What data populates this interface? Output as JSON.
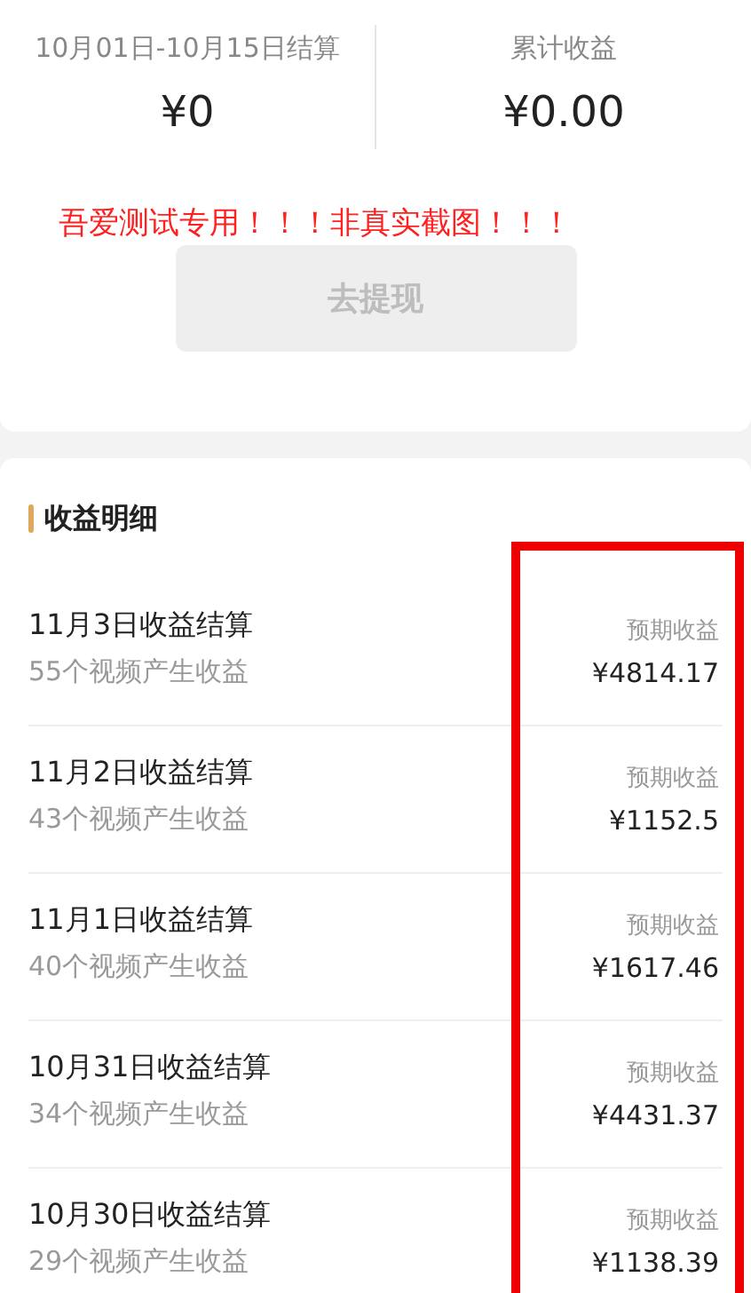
{
  "summary": [
    {
      "label": "10月01日-10月15日结算",
      "value": "¥0"
    },
    {
      "label": "累计收益",
      "value": "¥0.00"
    }
  ],
  "withdraw_button": {
    "label": "去提现",
    "disabled": true
  },
  "overlay_note": "吾爱测试专用！！！非真实截图！！！",
  "details": {
    "title": "收益明细",
    "rows": [
      {
        "title": "11月3日收益结算",
        "subtitle": "55个视频产生收益",
        "amount_label": "预期收益",
        "amount": "¥4814.17"
      },
      {
        "title": "11月2日收益结算",
        "subtitle": "43个视频产生收益",
        "amount_label": "预期收益",
        "amount": "¥1152.5"
      },
      {
        "title": "11月1日收益结算",
        "subtitle": "40个视频产生收益",
        "amount_label": "预期收益",
        "amount": "¥1617.46"
      },
      {
        "title": "10月31日收益结算",
        "subtitle": "34个视频产生收益",
        "amount_label": "预期收益",
        "amount": "¥4431.37"
      },
      {
        "title": "10月30日收益结算",
        "subtitle": "29个视频产生收益",
        "amount_label": "预期收益",
        "amount": "¥1138.39"
      }
    ]
  }
}
